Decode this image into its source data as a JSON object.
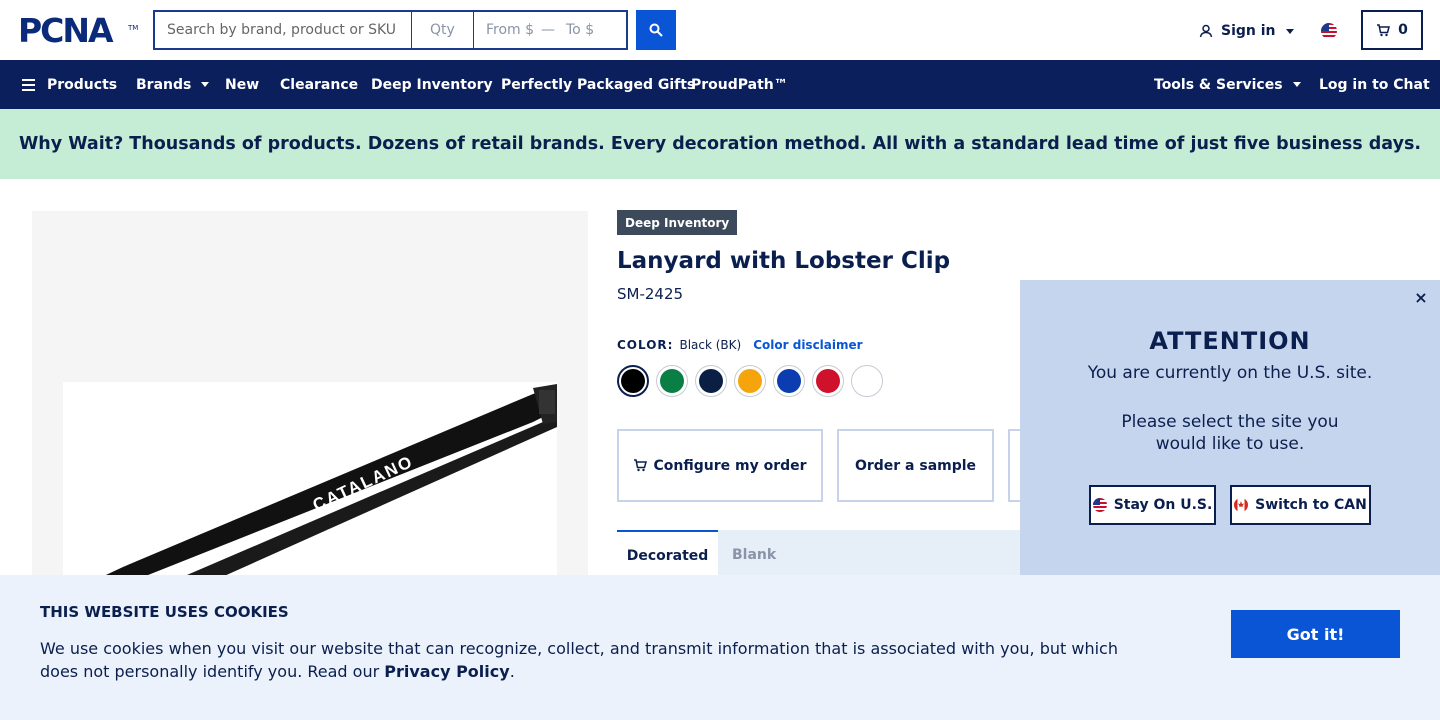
{
  "header": {
    "logo_text": "PCNA",
    "logo_tm": "TM",
    "search_placeholder": "Search by brand, product or SKU",
    "qty_placeholder": "Qty",
    "from_placeholder": "From $",
    "dash": "—",
    "to_placeholder": "To $",
    "sign_in": "Sign in",
    "cart_count": "0"
  },
  "nav": {
    "products": "Products",
    "brands": "Brands",
    "new": "New",
    "clearance": "Clearance",
    "deep_inventory": "Deep Inventory",
    "gifts": "Perfectly Packaged Gifts",
    "proudpath": "ProudPath™",
    "tools": "Tools & Services",
    "chat": "Log in to Chat"
  },
  "banner": {
    "text": "Why Wait? Thousands of products. Dozens of retail brands. Every decoration method. All with a standard lead time of just five business days."
  },
  "product": {
    "badge": "Deep Inventory",
    "title": "Lanyard with Lobster Clip",
    "sku": "SM-2425",
    "color_label": "COLOR:",
    "color_value": "Black (BK)",
    "color_disclaimer": "Color disclaimer",
    "swatches": [
      "#000000",
      "#0a7f45",
      "#0b1f44",
      "#f5a40c",
      "#0b3db0",
      "#d0112b",
      "#ffffff"
    ],
    "lanyard_text_1": "CATALANO",
    "lanyard_text_2": "CATALANO"
  },
  "actions": {
    "configure": "Configure my order",
    "sample": "Order a sample"
  },
  "tabs": {
    "decorated": "Decorated",
    "blank": "Blank"
  },
  "modal": {
    "title": "ATTENTION",
    "line1": "You are currently on the U.S. site.",
    "line2": "Please select the site you",
    "line3": "would like to use.",
    "stay": "Stay On U.S.",
    "switch": "Switch to CAN",
    "close": "×"
  },
  "cookie": {
    "title": "THIS WEBSITE USES COOKIES",
    "text_before": "We use cookies when you visit our website that can recognize, collect, and transmit information that is associated with you, but which does not personally identify you. Read our ",
    "link": "Privacy Policy",
    "text_after": ".",
    "button": "Got it!"
  },
  "colors": {
    "navy": "#0b1f5c",
    "accent_blue": "#0a55d6",
    "banner_green": "#c5ecd4",
    "modal_bg": "#c5d5ee",
    "cookie_bg": "#ebf2fb"
  }
}
